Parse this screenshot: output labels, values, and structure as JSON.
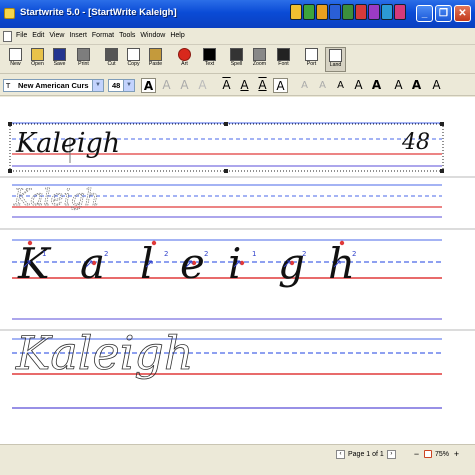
{
  "window": {
    "title": "Startwrite 5.0 - [StartWrite Kaleigh]",
    "minimize_label": "_",
    "restore_label": "❐",
    "close_label": "✕"
  },
  "menu": [
    "File",
    "Edit",
    "View",
    "Insert",
    "Format",
    "Tools",
    "Window",
    "Help"
  ],
  "toolbar": [
    {
      "label": "New",
      "icon": "new-document-icon",
      "color": "#ffffff"
    },
    {
      "label": "Open",
      "icon": "open-folder-icon",
      "color": "#e8c24a"
    },
    {
      "label": "Save",
      "icon": "save-disk-icon",
      "color": "#23358f"
    },
    {
      "label": "Print",
      "icon": "printer-icon",
      "color": "#7d7d7d"
    },
    {
      "label": "Cut",
      "icon": "scissors-icon",
      "color": "#555555"
    },
    {
      "label": "Copy",
      "icon": "copy-icon",
      "color": "#ffffff"
    },
    {
      "label": "Paste",
      "icon": "paste-icon",
      "color": "#c49a3c"
    },
    {
      "label": "Art",
      "icon": "apple-art-icon",
      "color": "#d8281c"
    },
    {
      "label": "Text",
      "icon": "text-t-icon",
      "color": "#000000"
    },
    {
      "label": "Spell",
      "icon": "spell-check-icon",
      "color": "#333333"
    },
    {
      "label": "Zoom",
      "icon": "magnifier-icon",
      "color": "#888888"
    },
    {
      "label": "Font",
      "icon": "font-pen-icon",
      "color": "#222222"
    },
    {
      "label": "Port",
      "icon": "portrait-page-icon",
      "color": "#ffffff"
    },
    {
      "label": "Land",
      "icon": "landscape-page-icon",
      "color": "#ffffff"
    }
  ],
  "format_bar": {
    "font_name": "New American Curs",
    "font_size": "48",
    "style_buttons": [
      "A",
      "A",
      "A",
      "A",
      "A",
      "A",
      "A",
      "A",
      "A",
      "A",
      "A",
      "A",
      "A",
      "A",
      "A",
      "A"
    ]
  },
  "document": {
    "name_text": "Kaleigh",
    "size_text": "48",
    "letters": [
      "K",
      "a",
      "l",
      "e",
      "i",
      "g",
      "h"
    ],
    "colors": {
      "midline": "#4a67e8",
      "baseline": "#e03a3a",
      "bottomline": "#5a4ed8",
      "ink": "#111111",
      "arrows": "#3344cc",
      "start_dot": "#e03a3a"
    }
  },
  "status": {
    "prev_label": "‹",
    "page_text": "Page 1 of 1",
    "next_label": "›",
    "zoom_minus": "−",
    "zoom_text": "75%",
    "zoom_plus": "+"
  }
}
